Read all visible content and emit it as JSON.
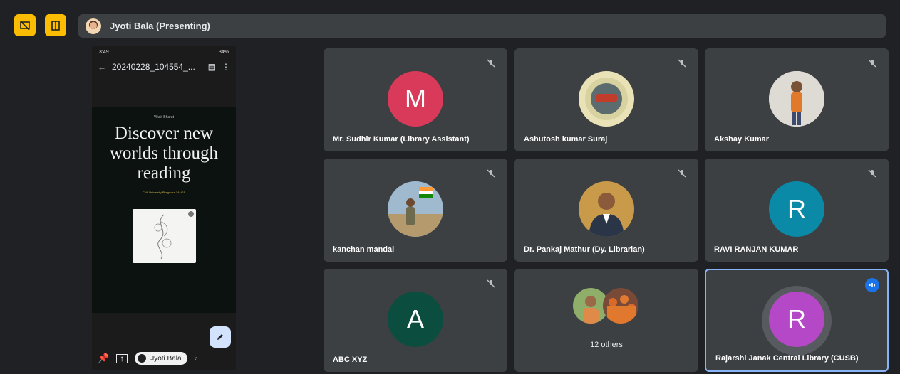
{
  "topbar": {
    "presenting_label": "Jyoti Bala (Presenting)",
    "icons": [
      "screen-share-off-icon",
      "layout-icon"
    ]
  },
  "phone": {
    "status": {
      "time": "3:49",
      "right": "34%"
    },
    "appbar": {
      "title": "20240228_104554_..."
    },
    "doc": {
      "kicker": "Viksit Bharat",
      "heading": "Discover new worlds through reading",
      "sub": "CHL University Phagwara 144411"
    },
    "chip_label": "Jyoti Bala"
  },
  "tiles": [
    {
      "name": "Mr. Sudhir Kumar (Library Assistant)",
      "initial": "M",
      "color": "#d93a5a",
      "muted": true
    },
    {
      "name": "Ashutosh kumar Suraj",
      "initial": "",
      "muted": true
    },
    {
      "name": "Akshay Kumar",
      "initial": "",
      "muted": true
    },
    {
      "name": "kanchan mandal",
      "initial": "",
      "muted": true
    },
    {
      "name": "Dr. Pankaj Mathur (Dy. Librarian)",
      "initial": "",
      "muted": true
    },
    {
      "name": "RAVI RANJAN KUMAR",
      "initial": "R",
      "color": "#0b8aa8",
      "muted": true
    },
    {
      "name": "ABC XYZ",
      "initial": "A",
      "color": "#0b4d3f",
      "muted": true
    },
    {
      "others_label": "12 others"
    },
    {
      "name": "Rajarshi Janak Central Library (CUSB)",
      "initial": "R",
      "color": "#b548c6",
      "speaking": true
    }
  ]
}
